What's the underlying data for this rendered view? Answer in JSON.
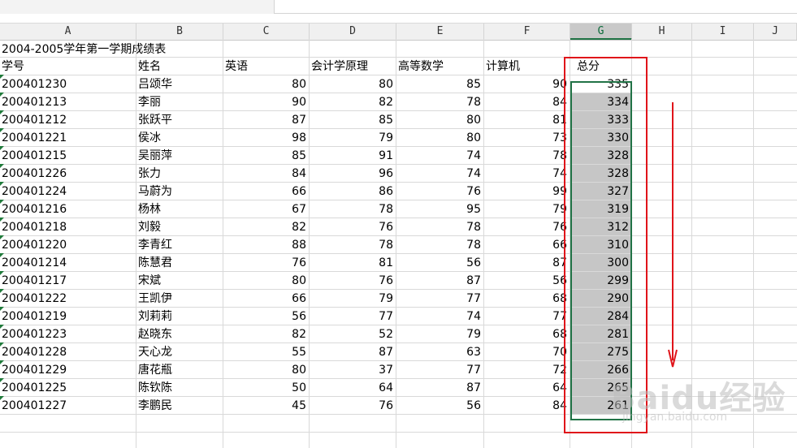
{
  "columns": [
    "A",
    "B",
    "C",
    "D",
    "E",
    "F",
    "G",
    "H",
    "I",
    "J"
  ],
  "selected_column": "G",
  "title": "2004-2005学年第一学期成绩表",
  "headers": [
    "学号",
    "姓名",
    "英语",
    "会计学原理",
    "高等数学",
    "计算机",
    "总分"
  ],
  "rows": [
    [
      "200401230",
      "吕颂华",
      "80",
      "80",
      "85",
      "90",
      "335"
    ],
    [
      "200401213",
      "李丽",
      "90",
      "82",
      "78",
      "84",
      "334"
    ],
    [
      "200401212",
      "张跃平",
      "87",
      "85",
      "80",
      "81",
      "333"
    ],
    [
      "200401221",
      "侯冰",
      "98",
      "79",
      "80",
      "73",
      "330"
    ],
    [
      "200401215",
      "吴丽萍",
      "85",
      "91",
      "74",
      "78",
      "328"
    ],
    [
      "200401226",
      "张力",
      "84",
      "96",
      "74",
      "74",
      "328"
    ],
    [
      "200401224",
      "马蔚为",
      "66",
      "86",
      "76",
      "99",
      "327"
    ],
    [
      "200401216",
      "杨林",
      "67",
      "78",
      "95",
      "79",
      "319"
    ],
    [
      "200401218",
      "刘毅",
      "82",
      "76",
      "78",
      "76",
      "312"
    ],
    [
      "200401220",
      "李青红",
      "88",
      "78",
      "78",
      "66",
      "310"
    ],
    [
      "200401214",
      "陈慧君",
      "76",
      "81",
      "56",
      "87",
      "300"
    ],
    [
      "200401217",
      "宋斌",
      "80",
      "76",
      "87",
      "56",
      "299"
    ],
    [
      "200401222",
      "王凯伊",
      "66",
      "79",
      "77",
      "68",
      "290"
    ],
    [
      "200401219",
      "刘莉莉",
      "56",
      "77",
      "74",
      "77",
      "284"
    ],
    [
      "200401223",
      "赵晓东",
      "82",
      "52",
      "79",
      "68",
      "281"
    ],
    [
      "200401228",
      "天心龙",
      "55",
      "87",
      "63",
      "70",
      "275"
    ],
    [
      "200401229",
      "唐花瓶",
      "80",
      "37",
      "77",
      "72",
      "266"
    ],
    [
      "200401225",
      "陈钦陈",
      "50",
      "64",
      "87",
      "64",
      "265"
    ],
    [
      "200401227",
      "李鹏民",
      "45",
      "76",
      "56",
      "84",
      "261"
    ]
  ],
  "annotation": {
    "highlight_color": "#e0141a",
    "selection_color": "#217346",
    "arrow_direction": "down"
  },
  "watermark": {
    "text": "Baidu经验",
    "subtext": "jingyan.baidu.com"
  }
}
